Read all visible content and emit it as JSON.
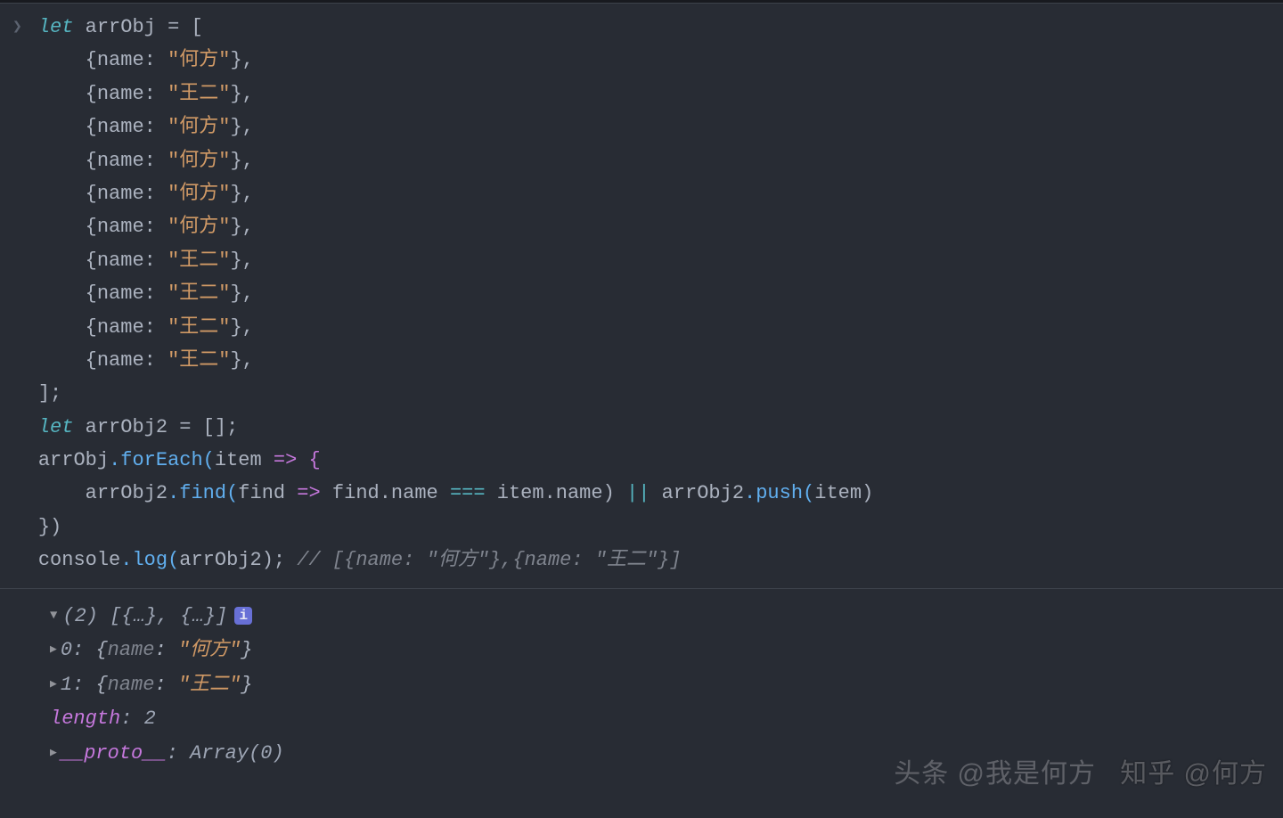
{
  "code": {
    "let1": "let",
    "arrObj": "arrObj",
    "eq": " = [",
    "items": [
      "何方",
      "王二",
      "何方",
      "何方",
      "何方",
      "何方",
      "王二",
      "王二",
      "王二",
      "王二"
    ],
    "name_key": "name",
    "close_arr": "];",
    "let2": "let",
    "arrObj2": "arrObj2",
    "eq2": " = [];",
    "forEach": ".forEach(",
    "item": "item",
    "arrow": " => {",
    "find": ".find(",
    "findParam": "find",
    "arrow2": " => ",
    "findName": "find.name",
    "tripleEq": " === ",
    "itemName": "item.name",
    "closeFind": ")",
    "or": " || ",
    "push": ".push(",
    "closePush": ")",
    "closeFE": "})",
    "console": "console",
    "log": ".log(",
    "closeLog": ");",
    "comment": " // [{name: \"何方\"},{name: \"王二\"}]"
  },
  "out": {
    "count": "(2)",
    "summary": " [{…}, {…}]",
    "info": "i",
    "rows": [
      {
        "idx": "0",
        "key": "name",
        "val": "\"何方\""
      },
      {
        "idx": "1",
        "key": "name",
        "val": "\"王二\""
      }
    ],
    "length_key": "length",
    "length_val": "2",
    "proto_key": "__proto__",
    "proto_val": "Array(0)"
  },
  "watermark1": "头条 @我是何方",
  "watermark2": "知乎 @何方"
}
